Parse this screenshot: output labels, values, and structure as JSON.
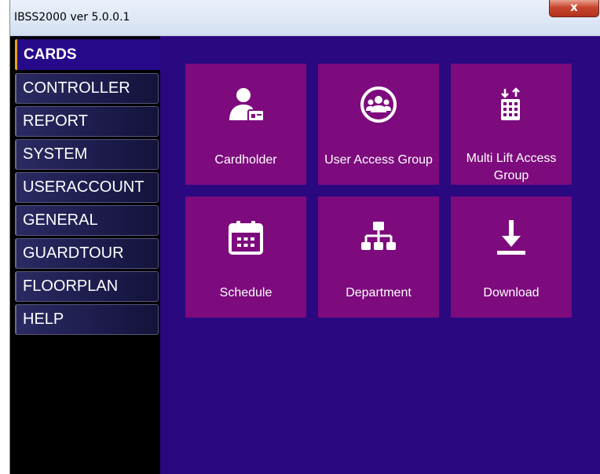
{
  "window": {
    "title": "IBSS2000 ver 5.0.0.1",
    "close_symbol": "x"
  },
  "colors": {
    "content_background": "#2a0880",
    "tile_background": "#7d0b7d",
    "sidebar_background": "#000000",
    "active_indicator": "#e8a020"
  },
  "sidebar": {
    "active_index": 0,
    "items": [
      {
        "label": "CARDS"
      },
      {
        "label": "CONTROLLER"
      },
      {
        "label": "REPORT"
      },
      {
        "label": "SYSTEM"
      },
      {
        "label": "USERACCOUNT"
      },
      {
        "label": "GENERAL"
      },
      {
        "label": "GUARDTOUR"
      },
      {
        "label": "FLOORPLAN"
      },
      {
        "label": "HELP"
      }
    ]
  },
  "tiles": [
    {
      "label": "Cardholder",
      "icon": "cardholder-icon"
    },
    {
      "label": "User Access Group",
      "icon": "user-group-icon"
    },
    {
      "label": "Multi Lift Access Group",
      "icon": "lift-access-icon"
    },
    {
      "label": "Schedule",
      "icon": "calendar-icon"
    },
    {
      "label": "Department",
      "icon": "org-chart-icon"
    },
    {
      "label": "Download",
      "icon": "download-icon"
    }
  ]
}
